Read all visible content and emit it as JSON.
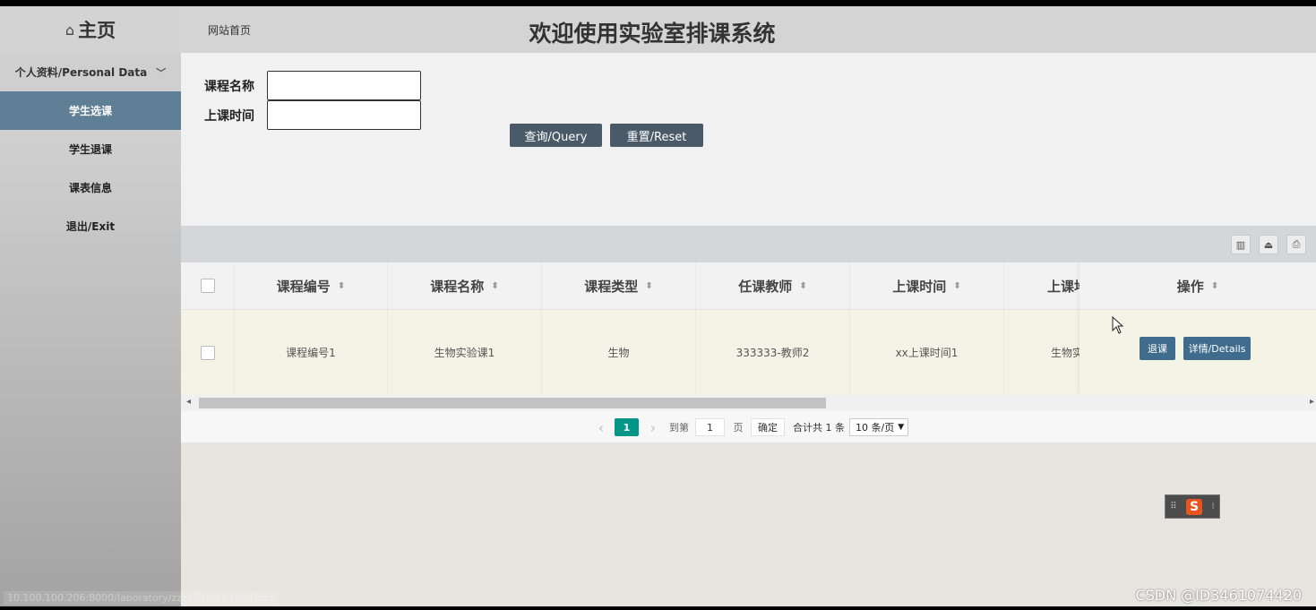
{
  "sidebar": {
    "home": "主页",
    "personal": "个人资料/Personal Data",
    "items": [
      {
        "label": "学生选课"
      },
      {
        "label": "学生退课"
      },
      {
        "label": "课表信息"
      },
      {
        "label": "退出/Exit"
      }
    ],
    "status_url": "10.100.100.206:8000/laboratory/zzzz/list/#x.html?zzz"
  },
  "header": {
    "site_home": "网站首页",
    "title": "欢迎使用实验室排课系统"
  },
  "search": {
    "course_name_label": "课程名称",
    "class_time_label": "上课时间",
    "query_btn": "查询/Query",
    "reset_btn": "重置/Reset"
  },
  "table": {
    "columns": [
      "课程编号",
      "课程名称",
      "课程类型",
      "任课教师",
      "上课时间",
      "上课地"
    ],
    "operation_header": "操作",
    "rows": [
      {
        "cells": [
          "课程编号1",
          "生物实验课1",
          "生物",
          "333333-教师2",
          "xx上课时间1",
          "生物实"
        ]
      }
    ],
    "actions": {
      "drop": "退课",
      "details": "详情/Details"
    }
  },
  "pager": {
    "prev": "‹",
    "current": "1",
    "next": "›",
    "goto_label": "到第",
    "goto_value": "1",
    "page_unit": "页",
    "confirm": "确定",
    "total": "合计共 1 条",
    "per_page": "10 条/页"
  },
  "watermark": "CSDN @ID3461074420",
  "colors": {
    "sidebar_active": "#5e7f96",
    "button": "#4a5a68",
    "pager_active": "#009688",
    "row_bg": "#f3f3e6"
  }
}
